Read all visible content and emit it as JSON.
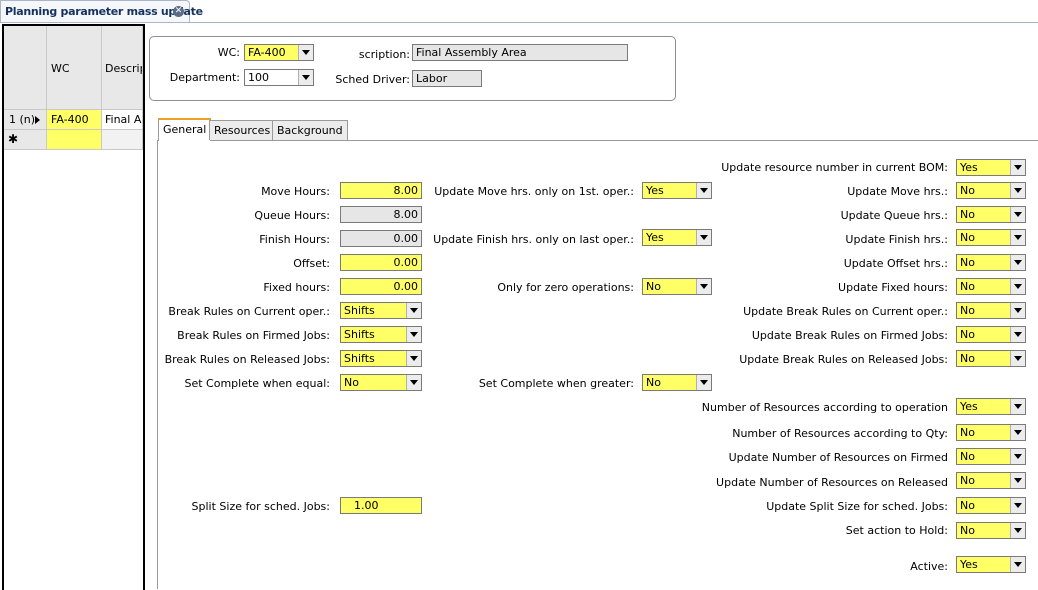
{
  "doc_tab": {
    "title": "Planning parameter mass update"
  },
  "grid": {
    "columns": [
      "WC",
      "Descrip"
    ],
    "rows": [
      {
        "indicator": "1 (n)",
        "wc": "FA-400",
        "desc": "Final As"
      }
    ],
    "new_row_marker": "✱"
  },
  "header": {
    "wc_label": "WC:",
    "wc_value": "FA-400",
    "dept_label": "Department:",
    "dept_value": "100",
    "desc_label": "scription:",
    "desc_value": "Final Assembly Area",
    "sched_label": "Sched Driver:",
    "sched_value": "Labor"
  },
  "tabs": [
    "General",
    "Resources",
    "Background"
  ],
  "left": {
    "move_hours_label": "Move Hours:",
    "move_hours": "8.00",
    "queue_hours_label": "Queue Hours:",
    "queue_hours": "8.00",
    "finish_hours_label": "Finish Hours:",
    "finish_hours": "0.00",
    "offset_label": "Offset:",
    "offset": "0.00",
    "fixed_hours_label": "Fixed hours:",
    "fixed_hours": "0.00",
    "br_current_label": "Break Rules on Current oper.:",
    "br_current": "Shifts",
    "br_firmed_label": "Break Rules on Firmed Jobs:",
    "br_firmed": "Shifts",
    "br_released_label": "Break Rules on Released Jobs:",
    "br_released": "Shifts",
    "set_complete_equal_label": "Set Complete when equal:",
    "set_complete_equal": "No",
    "split_size_label": "Split Size for sched. Jobs:",
    "split_size": "1.00"
  },
  "middle": {
    "move_first_label": "Update Move hrs. only on 1st. oper.:",
    "move_first": "Yes",
    "finish_last_label": "Update Finish hrs. only on last oper.:",
    "finish_last": "Yes",
    "zero_ops_label": "Only for zero operations:",
    "zero_ops": "No",
    "set_complete_greater_label": "Set Complete when greater:",
    "set_complete_greater": "No"
  },
  "right": {
    "bom_label": "Update resource number in current BOM:",
    "bom": "Yes",
    "move_label": "Update Move hrs.:",
    "move": "No",
    "queue_label": "Update Queue hrs.:",
    "queue": "No",
    "finish_label": "Update Finish hrs.:",
    "finish": "No",
    "offset_label": "Update Offset hrs.:",
    "offset": "No",
    "fixed_label": "Update Fixed hours:",
    "fixed": "No",
    "brc_label": "Update Break Rules on Current oper.:",
    "brc": "No",
    "brf_label": "Update Break Rules on Firmed Jobs:",
    "brf": "No",
    "brr_label": "Update Break Rules on Released Jobs:",
    "brr": "No",
    "nr_op_label": "Number of Resources according to operation",
    "nr_op": "Yes",
    "nr_qty_label": "Number of Resources according to Qty:",
    "nr_qty": "No",
    "nr_firmed_label": "Update Number of Resources on Firmed",
    "nr_firmed": "No",
    "nr_released_label": "Update Number of Resources on Released",
    "nr_released": "No",
    "split_label": "Update Split Size for sched. Jobs:",
    "split": "No",
    "hold_label": "Set action to Hold:",
    "hold": "No",
    "active_label": "Active:",
    "active": "Yes"
  }
}
